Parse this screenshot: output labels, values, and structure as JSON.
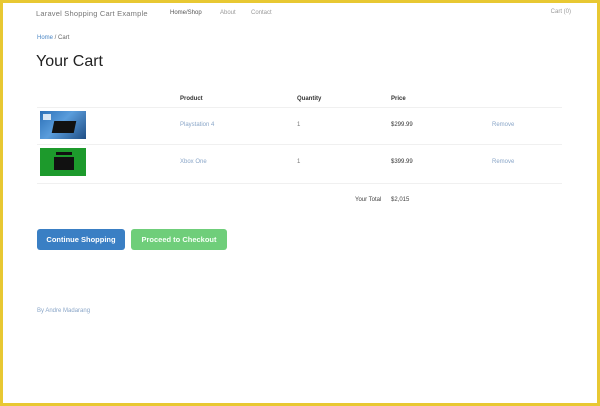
{
  "navbar": {
    "brand": "Laravel Shopping Cart Example",
    "links": [
      {
        "label": "Home/Shop"
      },
      {
        "label": "About"
      },
      {
        "label": "Contact"
      }
    ],
    "cart": "Cart (0)"
  },
  "breadcrumb": {
    "home": "Home",
    "sep": " / ",
    "current": "Cart"
  },
  "title": "Your Cart",
  "table": {
    "headers": [
      "Product",
      "Quantity",
      "Price"
    ],
    "rows": [
      {
        "name": "Playstation 4",
        "qty": "1",
        "price": "$299.99",
        "remove": "Remove",
        "image": "ps4-image"
      },
      {
        "name": "Xbox One",
        "qty": "1",
        "price": "$399.99",
        "remove": "Remove",
        "image": "xbox-image"
      }
    ],
    "total_label": "Your Total",
    "total_value": "$2,015"
  },
  "buttons": {
    "continue": "Continue Shopping",
    "checkout": "Proceed to Checkout"
  },
  "footer": "By Andre Madarang",
  "colors": {
    "frame": "#e8c832",
    "primary": "#3a7fc4",
    "success": "#6fce7a",
    "link": "#8aa6c8"
  }
}
